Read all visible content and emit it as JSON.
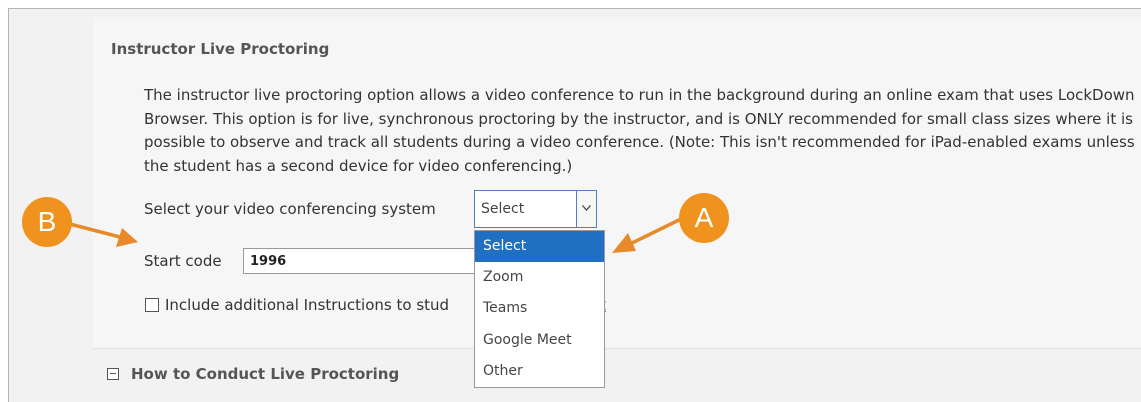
{
  "panel": {
    "title": "Instructor Live Proctoring",
    "description_lines": [
      "The instructor live proctoring option allows a video conference to run in the background during an online exam that uses LockDown",
      "Browser. This option is for live, synchronous proctoring by the instructor, and is ONLY recommended for small class sizes where it is",
      "possible to observe and track all students during a video conference. (Note: This isn't recommended for iPad-enabled exams unless",
      "the student has a second device for video conferencing.)"
    ]
  },
  "video_system": {
    "label": "Select your video conferencing system",
    "selected_value": "Select",
    "options": [
      "Select",
      "Zoom",
      "Teams",
      "Google Meet",
      "Other"
    ]
  },
  "start_code": {
    "label": "Start code",
    "value": "1996"
  },
  "instructions_checkbox": {
    "label": "Include additional Instructions to stud",
    "trailing_link_fragment": "t",
    "checked": false
  },
  "section": {
    "title": "How to Conduct Live Proctoring"
  },
  "callouts": {
    "a_label": "A",
    "b_label": "B",
    "color": "#f0921e"
  },
  "colors": {
    "selected_option": "#1f6fc3",
    "select_border": "#4e7fbf"
  }
}
